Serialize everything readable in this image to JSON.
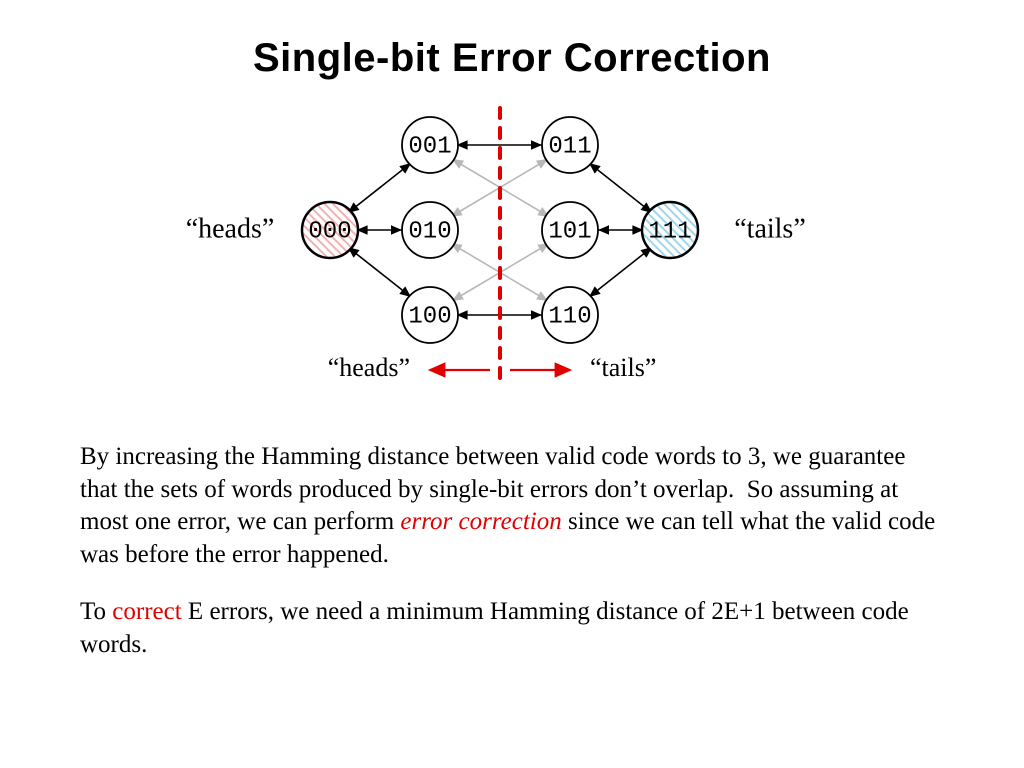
{
  "title": "Single-bit Error Correction",
  "labels": {
    "left_side": "“heads”",
    "right_side": "“tails”",
    "bottom_left": "“heads”",
    "bottom_right": "“tails”"
  },
  "nodes": {
    "n000": "000",
    "n001": "001",
    "n010": "010",
    "n011": "011",
    "n100": "100",
    "n101": "101",
    "n110": "110",
    "n111": "111"
  },
  "body": {
    "p1a": "By increasing the Hamming distance between valid code words to 3, we guarantee that the sets of words produced by single-bit errors don’t overlap.  So assuming at most one error, we can perform ",
    "p1_em": "error correction",
    "p1b": " since we can tell what the valid code was before the error happened.",
    "p2a": "To ",
    "p2_red": "correct",
    "p2b": " E errors, we need a minimum Hamming distance of 2E+1 between code words."
  },
  "colors": {
    "heads_fill": "#f6c9c9",
    "tails_fill": "#bfe6f2",
    "divider": "#e00000",
    "grey_arrow": "#b8b8b8",
    "black": "#000000",
    "red_arrow": "#e00000"
  },
  "chart_data": {
    "type": "diagram",
    "title": "Single-bit Error Correction",
    "description": "Hamming-distance-3 code on 3-bit words. 000 encodes heads, 111 encodes tails. Single-bit neighbor sets do not overlap.",
    "codewords": [
      {
        "word": "000",
        "meaning": "heads",
        "highlighted": true,
        "fill": "heads"
      },
      {
        "word": "111",
        "meaning": "tails",
        "highlighted": true,
        "fill": "tails"
      },
      {
        "word": "001",
        "highlighted": false
      },
      {
        "word": "010",
        "highlighted": false
      },
      {
        "word": "011",
        "highlighted": false
      },
      {
        "word": "100",
        "highlighted": false
      },
      {
        "word": "101",
        "highlighted": false
      },
      {
        "word": "110",
        "highlighted": false
      }
    ],
    "black_edges_bidirectional": [
      [
        "000",
        "001"
      ],
      [
        "000",
        "010"
      ],
      [
        "000",
        "100"
      ],
      [
        "111",
        "011"
      ],
      [
        "111",
        "101"
      ],
      [
        "111",
        "110"
      ],
      [
        "001",
        "011"
      ],
      [
        "100",
        "110"
      ]
    ],
    "grey_edges_bidirectional": [
      [
        "010",
        "011"
      ],
      [
        "010",
        "110"
      ],
      [
        "101",
        "001"
      ],
      [
        "101",
        "100"
      ]
    ],
    "divider": {
      "between": [
        "left-cluster (000 neighbors)",
        "right-cluster (111 neighbors)"
      ],
      "style": "dashed red vertical"
    },
    "decode_regions": {
      "left": "heads",
      "right": "tails"
    },
    "rule": "To correct E errors, minimum Hamming distance = 2E+1"
  }
}
